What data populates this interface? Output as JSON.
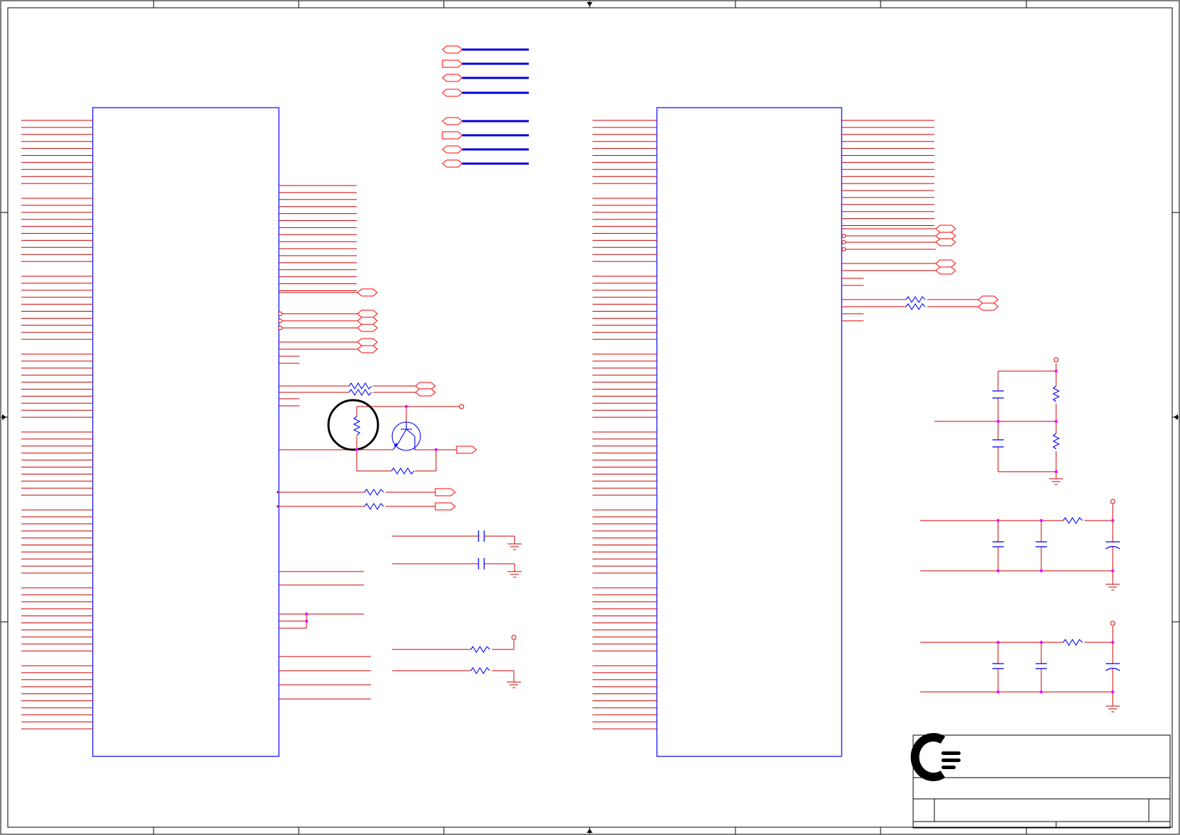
{
  "colors": {
    "wire": "#cc0000",
    "pin": "#cc0000",
    "part": "#0000ff",
    "bus": "#0000dd",
    "port": "#ff0000",
    "junction": "#ff00ff",
    "frame": "#000000",
    "logo": "#000000"
  },
  "symbols": {
    "left_ic": "ic-symbol",
    "right_ic": "ic-symbol",
    "transistor": "npn-transistor-icon",
    "resistor": "resistor-icon",
    "capacitor": "capacitor-icon",
    "polarized_capacitor": "polarized-capacitor-icon",
    "ground": "ground-icon",
    "power_pin": "power-circle-icon",
    "port": "port-icon",
    "logo": "company-logo"
  },
  "title_block": {}
}
